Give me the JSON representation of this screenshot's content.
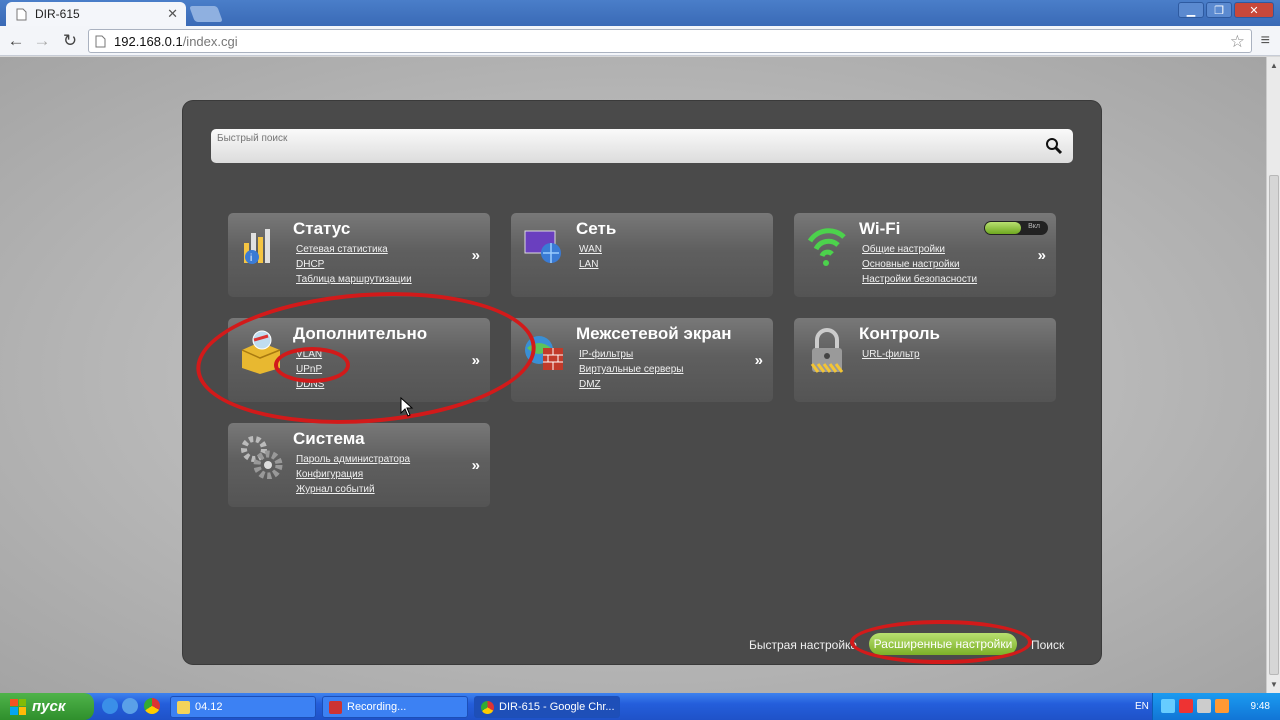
{
  "browser": {
    "tab_title": "DIR-615",
    "address_host": "192.168.0.1",
    "address_path": "/index.cgi"
  },
  "router": {
    "search_placeholder": "Быстрый поиск",
    "tiles": [
      {
        "title": "Статус",
        "links": [
          "Сетевая статистика",
          "DHCP",
          "Таблица маршрутизации"
        ],
        "arrow": "»"
      },
      {
        "title": "Сеть",
        "links": [
          "WAN",
          "LAN"
        ],
        "arrow": ""
      },
      {
        "title": "Wi-Fi",
        "links": [
          "Общие настройки",
          "Основные настройки",
          "Настройки безопасности"
        ],
        "arrow": "»",
        "toggle_label": "Вкл"
      },
      {
        "title": "Дополнительно",
        "links": [
          "VLAN",
          "UPnP",
          "DDNS"
        ],
        "arrow": "»"
      },
      {
        "title": "Межсетевой экран",
        "links": [
          "IP-фильтры",
          "Виртуальные серверы",
          "DMZ"
        ],
        "arrow": "»"
      },
      {
        "title": "Контроль",
        "links": [
          "URL-фильтр"
        ],
        "arrow": ""
      },
      {
        "title": "Система",
        "links": [
          "Пароль администратора",
          "Конфигурация",
          "Журнал событий"
        ],
        "arrow": "»"
      }
    ],
    "bottom": {
      "quick_setup": "Быстрая настройка",
      "advanced": "Расширенные настройки",
      "search": "Поиск"
    }
  },
  "taskbar": {
    "start": "пуск",
    "tasks": [
      "04.12",
      "Recording...",
      "DIR-615 - Google Chr..."
    ],
    "lang": "EN",
    "time": "9:48"
  }
}
